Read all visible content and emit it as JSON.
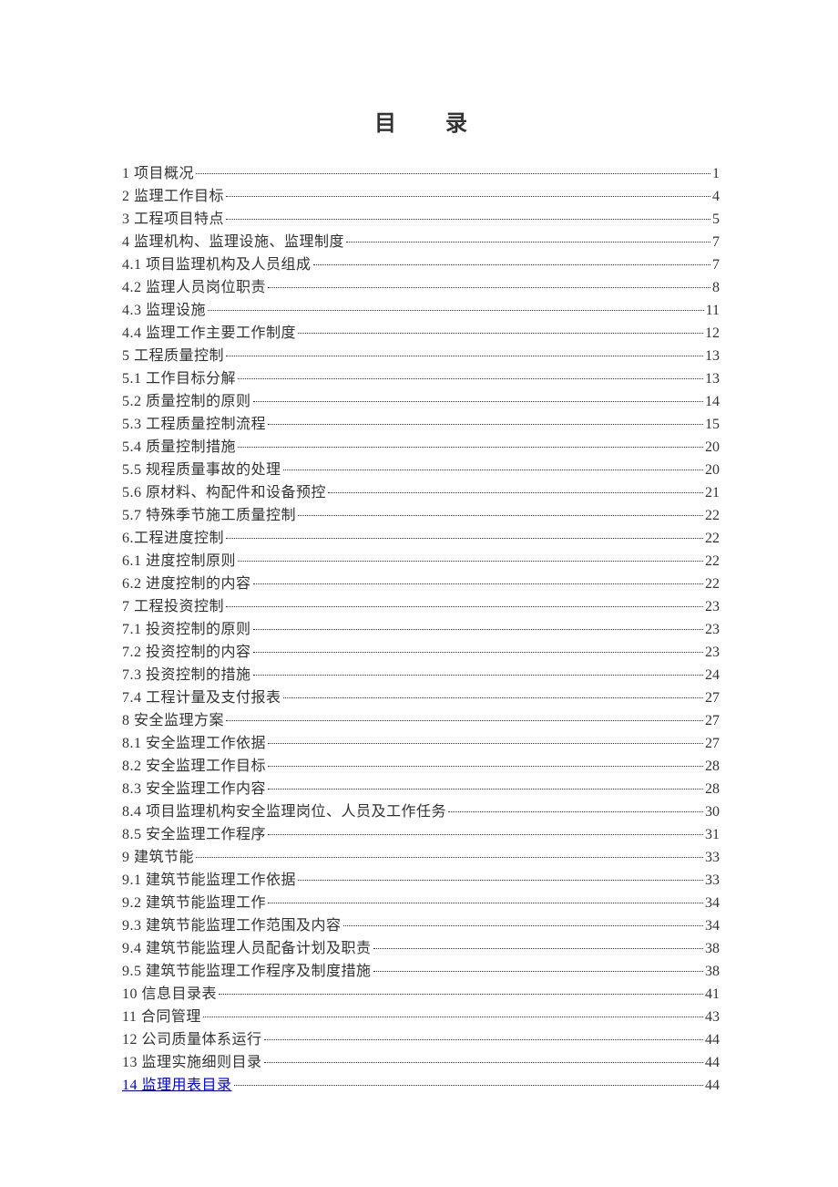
{
  "title": "目 录",
  "entries": [
    {
      "label": "1 项目概况",
      "page": "1",
      "link": false
    },
    {
      "label": "2  监理工作目标",
      "page": "4",
      "link": false
    },
    {
      "label": "3 工程项目特点",
      "page": "5",
      "link": false
    },
    {
      "label": "4 监理机构、监理设施、监理制度",
      "page": "7",
      "link": false
    },
    {
      "label": "4.1 项目监理机构及人员组成",
      "page": "7",
      "link": false
    },
    {
      "label": "4.2 监理人员岗位职责",
      "page": "8",
      "link": false
    },
    {
      "label": "4.3 监理设施",
      "page": "11",
      "link": false
    },
    {
      "label": "4.4 监理工作主要工作制度",
      "page": "12",
      "link": false
    },
    {
      "label": "5 工程质量控制",
      "page": "13",
      "link": false
    },
    {
      "label": "5.1 工作目标分解",
      "page": "13",
      "link": false
    },
    {
      "label": "5.2 质量控制的原则",
      "page": "14",
      "link": false
    },
    {
      "label": "5.3 工程质量控制流程",
      "page": "15",
      "link": false
    },
    {
      "label": "5.4 质量控制措施",
      "page": "20",
      "link": false
    },
    {
      "label": "5.5 规程质量事故的处理",
      "page": "20",
      "link": false
    },
    {
      "label": "5.6 原材料、构配件和设备预控",
      "page": "21",
      "link": false
    },
    {
      "label": "5.7 特殊季节施工质量控制",
      "page": "22",
      "link": false
    },
    {
      "label": "6.工程进度控制",
      "page": "22",
      "link": false
    },
    {
      "label": "6.1 进度控制原则",
      "page": "22",
      "link": false
    },
    {
      "label": "6.2 进度控制的内容",
      "page": "22",
      "link": false
    },
    {
      "label": "7 工程投资控制",
      "page": "23",
      "link": false
    },
    {
      "label": "7.1 投资控制的原则",
      "page": "23",
      "link": false
    },
    {
      "label": "7.2 投资控制的内容",
      "page": "23",
      "link": false
    },
    {
      "label": "7.3 投资控制的措施",
      "page": "24",
      "link": false
    },
    {
      "label": "7.4 工程计量及支付报表",
      "page": "27",
      "link": false
    },
    {
      "label": "8 安全监理方案",
      "page": "27",
      "link": false
    },
    {
      "label": "8.1 安全监理工作依据",
      "page": "27",
      "link": false
    },
    {
      "label": "8.2 安全监理工作目标",
      "page": "28",
      "link": false
    },
    {
      "label": "8.3 安全监理工作内容",
      "page": "28",
      "link": false
    },
    {
      "label": "8.4 项目监理机构安全监理岗位、人员及工作任务",
      "page": "30",
      "link": false
    },
    {
      "label": "8.5 安全监理工作程序",
      "page": "31",
      "link": false
    },
    {
      "label": "9 建筑节能",
      "page": "33",
      "link": false
    },
    {
      "label": "9.1 建筑节能监理工作依据",
      "page": "33",
      "link": false
    },
    {
      "label": "9.2 建筑节能监理工作",
      "page": "34",
      "link": false
    },
    {
      "label": "9.3 建筑节能监理工作范围及内容",
      "page": "34",
      "link": false
    },
    {
      "label": "9.4 建筑节能监理人员配备计划及职责",
      "page": "38",
      "link": false
    },
    {
      "label": "9.5 建筑节能监理工作程序及制度措施",
      "page": "38",
      "link": false
    },
    {
      "label": "10 信息目录表",
      "page": "41",
      "link": false
    },
    {
      "label": "11 合同管理",
      "page": "43",
      "link": false
    },
    {
      "label": "12 公司质量体系运行",
      "page": "44",
      "link": false
    },
    {
      "label": "13 监理实施细则目录",
      "page": "44",
      "link": false
    },
    {
      "label": "14 监理用表目录",
      "page": "44",
      "link": true
    }
  ]
}
